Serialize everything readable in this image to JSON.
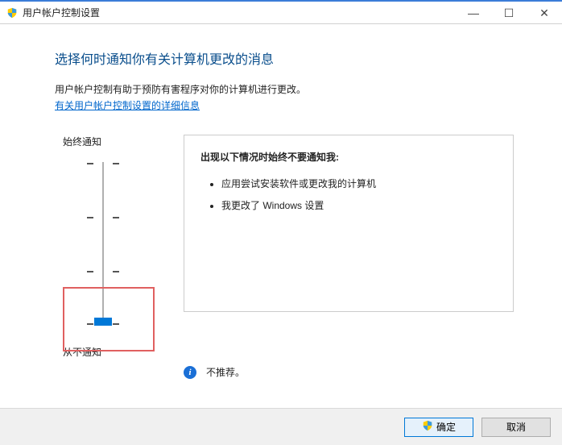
{
  "titlebar": {
    "title": "用户帐户控制设置"
  },
  "heading": "选择何时通知你有关计算机更改的消息",
  "description": "用户帐户控制有助于预防有害程序对你的计算机进行更改。",
  "link": "有关用户帐户控制设置的详细信息",
  "slider": {
    "top_label": "始终通知",
    "bottom_label": "从不通知",
    "position": 3
  },
  "info": {
    "title": "出现以下情况时始终不要通知我:",
    "bullets": [
      "应用尝试安装软件或更改我的计算机",
      "我更改了 Windows 设置"
    ]
  },
  "recommend": "不推荐。",
  "buttons": {
    "ok": "确定",
    "cancel": "取消"
  }
}
